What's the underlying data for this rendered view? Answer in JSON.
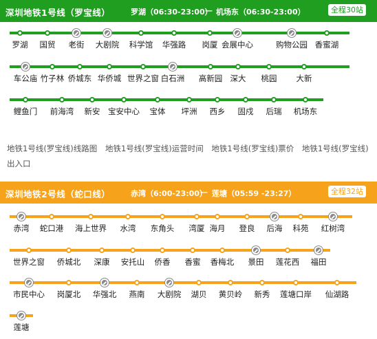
{
  "line1": {
    "name": "深圳地铁1号线（罗宝线）",
    "from": "罗湖（06:30-23:00）",
    "dash": "—",
    "to": "机场东（06:30-23:00）",
    "badge": "全程30站",
    "color": "#1f9e1f",
    "stations": [
      [
        "罗湖",
        "国贸",
        "老街",
        "大剧院",
        "科学馆",
        "华强路",
        "岗厦",
        "会展中心",
        "购物公园",
        "香蜜湖"
      ],
      [
        "车公庙",
        "竹子林",
        "侨城东",
        "华侨城",
        "世界之窗",
        "白石洲",
        "高新园",
        "深大",
        "桃园",
        "大新"
      ],
      [
        "鲤鱼门",
        "前海湾",
        "新安",
        "宝安中心",
        "宝体",
        "坪洲",
        "西乡",
        "固戍",
        "后瑞",
        "机场东"
      ]
    ],
    "links": [
      "地铁1号线(罗宝线)线路图",
      "地铁1号线(罗宝线)运营时间",
      "地铁1号线(罗宝线)票价",
      "地铁1号线(罗宝线)出入口"
    ]
  },
  "line2": {
    "name": "深圳地铁2号线（蛇口线）",
    "from": "赤湾（6:00-23:00）",
    "dash": "—",
    "to": "莲塘（05:59 -23:27）",
    "badge": "全程32站",
    "color": "#f7a21b",
    "stations": [
      [
        "赤湾",
        "蛇口港",
        "海上世界",
        "水湾",
        "东角头",
        "湾厦",
        "海月",
        "登良",
        "后海",
        "科苑",
        "红树湾"
      ],
      [
        "世界之窗",
        "侨城北",
        "深康",
        "安托山",
        "侨香",
        "香蜜",
        "香梅北",
        "景田",
        "莲花西",
        "福田"
      ],
      [
        "市民中心",
        "岗厦北",
        "华强北",
        "燕南",
        "大剧院",
        "湖贝",
        "黄贝岭",
        "新秀",
        "莲塘口岸",
        "仙湖路"
      ],
      [
        "莲塘"
      ]
    ]
  }
}
